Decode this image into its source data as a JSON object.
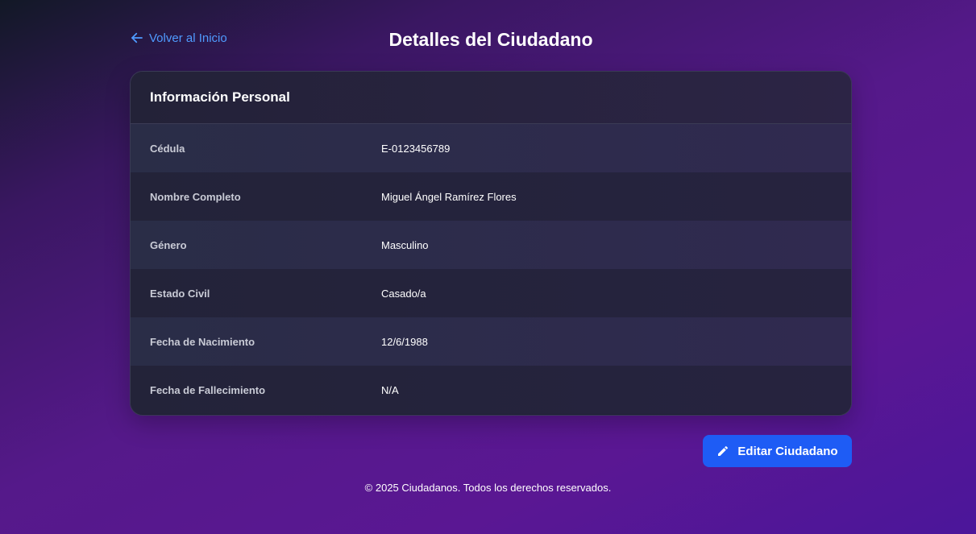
{
  "header": {
    "back_label": "Volver al Inicio",
    "title": "Detalles del Ciudadano"
  },
  "card": {
    "title": "Información Personal",
    "rows": [
      {
        "label": "Cédula",
        "value": "E-0123456789"
      },
      {
        "label": "Nombre Completo",
        "value": "Miguel Ángel Ramírez Flores"
      },
      {
        "label": "Género",
        "value": "Masculino"
      },
      {
        "label": "Estado Civil",
        "value": "Casado/a"
      },
      {
        "label": "Fecha de Nacimiento",
        "value": "12/6/1988"
      },
      {
        "label": "Fecha de Fallecimiento",
        "value": "N/A"
      }
    ]
  },
  "actions": {
    "edit_label": "Editar Ciudadano"
  },
  "footer": {
    "text": "© 2025 Ciudadanos. Todos los derechos reservados."
  },
  "colors": {
    "link": "#4f9bff",
    "button": "#1e5cf5"
  },
  "icons": {
    "back": "arrow-left-icon",
    "edit": "pencil-icon"
  }
}
